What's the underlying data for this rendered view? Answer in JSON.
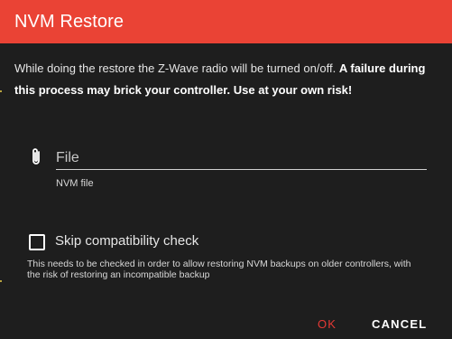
{
  "dialog": {
    "title": "NVM Restore",
    "warning_plain": "While doing the restore the Z-Wave radio will be turned on/off. ",
    "warning_bold": "A failure during this process may brick your controller. Use at your own risk!"
  },
  "file": {
    "icon": "paperclip-icon",
    "placeholder": "File",
    "hint": "NVM file"
  },
  "skip_check": {
    "checked": false,
    "label": "Skip compatibility check",
    "hint": "This needs to be checked in order to allow restoring NVM backups on older controllers, with the risk of restoring an incompatible backup"
  },
  "actions": {
    "ok_label": "OK",
    "cancel_label": "CANCEL"
  },
  "colors": {
    "title_bar": "#ea4335",
    "background": "#1e1e1e",
    "ok_button": "#e53935"
  }
}
